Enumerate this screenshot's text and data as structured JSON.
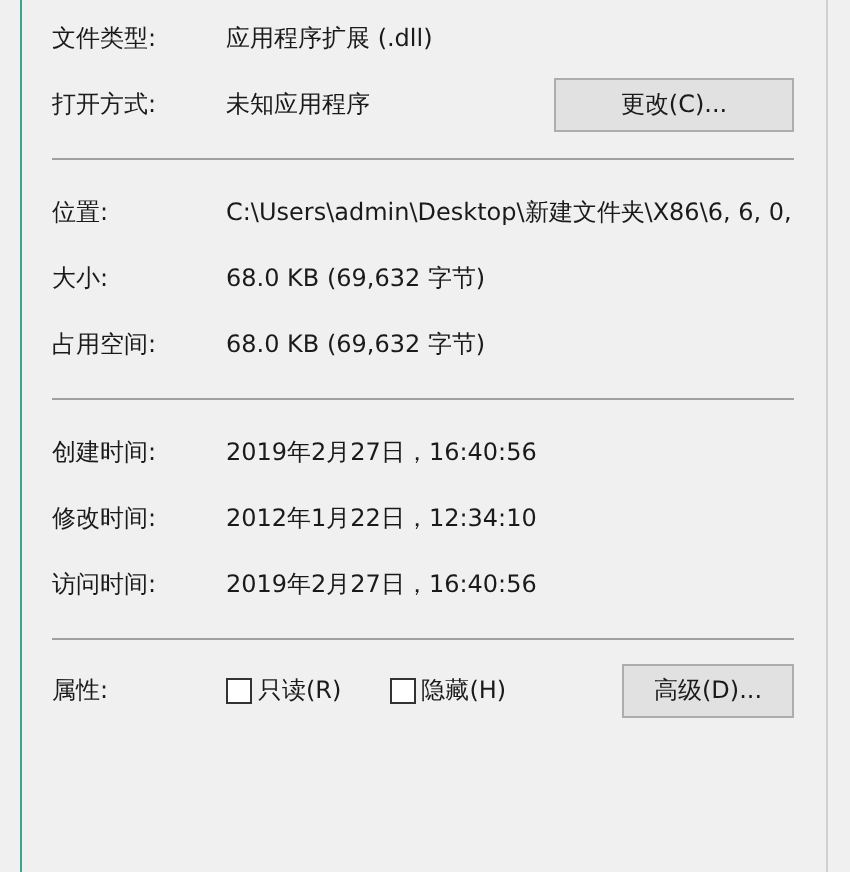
{
  "sections": [
    {
      "rows": [
        {
          "label": "文件类型:",
          "value": "应用程序扩展 (.dll)"
        },
        {
          "label": "打开方式:",
          "value": "未知应用程序",
          "button": "更改(C)..."
        }
      ]
    },
    {
      "rows": [
        {
          "label": "位置:",
          "value": "C:\\Users\\admin\\Desktop\\新建文件夹\\X86\\6, 6, 0,"
        },
        {
          "label": "大小:",
          "value": "68.0 KB (69,632 字节)"
        },
        {
          "label": "占用空间:",
          "value": "68.0 KB (69,632 字节)"
        }
      ]
    },
    {
      "rows": [
        {
          "label": "创建时间:",
          "value": "2019年2月27日，16:40:56"
        },
        {
          "label": "修改时间:",
          "value": "2012年1月22日，12:34:10"
        },
        {
          "label": "访问时间:",
          "value": "2019年2月27日，16:40:56"
        }
      ]
    }
  ],
  "attributes": {
    "label": "属性:",
    "checkboxes": [
      {
        "label": "只读(R)",
        "checked": false
      },
      {
        "label": "隐藏(H)",
        "checked": false
      }
    ],
    "button": "高级(D)..."
  }
}
